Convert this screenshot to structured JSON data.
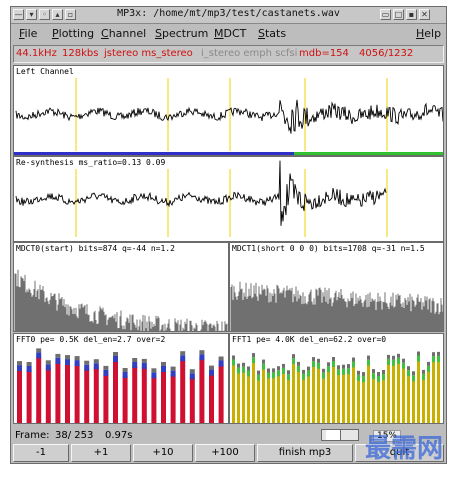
{
  "window": {
    "title": "MP3x: /home/mt/mp3/test/castanets.wav",
    "controls": [
      "window-menu-icon",
      "minimize-icon",
      "iconify-icon",
      "maximize-icon",
      "close-icon"
    ]
  },
  "menubar": {
    "items": [
      "File",
      "Plotting",
      "Channel",
      "Spectrum",
      "MDCT",
      "Stats"
    ],
    "help": "Help"
  },
  "infobar": {
    "samplerate": "44.1kHz",
    "bitrate": "128kbs",
    "mode": "jstereo ms_stereo",
    "flags": "i_stereo emph scfsi",
    "mdb": "mdb=154",
    "frames": "4056/1232"
  },
  "panels": {
    "left_channel": "Left Channel",
    "resynthesis": "Re-synthesis   ms_ratio=0.13  0.09",
    "mdct0": "MDCT0(start) bits=874 q=-44 n=1.2",
    "mdct1": "MDCT1(short 0 0 0) bits=1708 q=-31 n=1.5",
    "fft0": "FFT0 pe= 0.5K del_en=2.7 over=2",
    "fft1": "FFT1 pe= 4.0K del_en=62.2 over=0"
  },
  "status": {
    "frame_label": "Frame:",
    "frame_value": "38/ 253",
    "time": "0.97s",
    "percent": "15%",
    "slider_fraction": 0.15
  },
  "buttons": [
    "-1",
    "+1",
    "+10",
    "+100",
    "finish mp3",
    "quit"
  ],
  "watermark": "最需网",
  "colors": {
    "waveform": "#000000",
    "marker": "#f0d000",
    "blue_bar": "#3030c8",
    "green_bar": "#30c030",
    "fft_red": "#d01030",
    "fft_blue": "#3040c0",
    "fft_green": "#40c040",
    "fft_yellow": "#c8b000",
    "fft_grey": "#6e6e6e"
  }
}
